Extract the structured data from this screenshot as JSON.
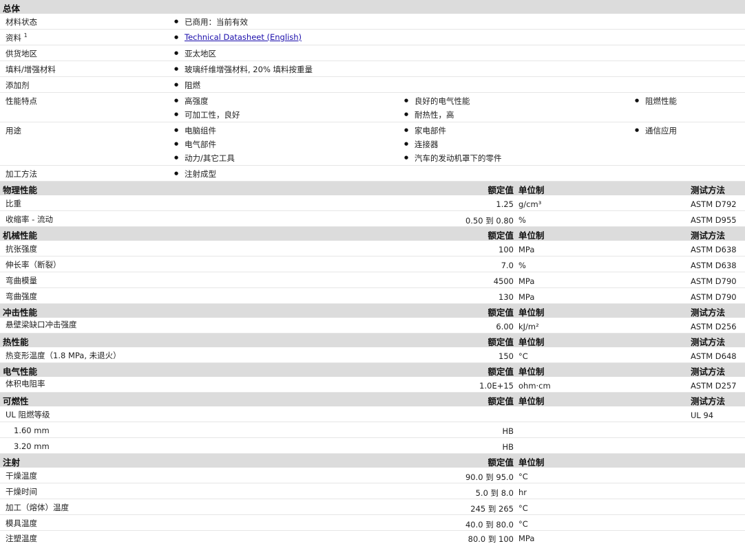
{
  "general": {
    "title": "总体",
    "rows": [
      {
        "label": "材料状态",
        "values": [
          "已商用：当前有效"
        ]
      },
      {
        "label": "资料",
        "sup": "1",
        "link": "Technical Datasheet (English)"
      },
      {
        "label": "供货地区",
        "values": [
          "亚太地区"
        ]
      },
      {
        "label": "填料/增强材料",
        "values": [
          "玻璃纤维增强材料, 20% 填料按重量"
        ]
      },
      {
        "label": "添加剂",
        "values": [
          "阻燃"
        ]
      },
      {
        "label": "性能特点",
        "cols": [
          [
            "高强度",
            "可加工性，良好"
          ],
          [
            "良好的电气性能",
            "耐热性，高"
          ],
          [
            "阻燃性能"
          ]
        ]
      },
      {
        "label": "用途",
        "cols": [
          [
            "电脑组件",
            "电气部件",
            "动力/其它工具"
          ],
          [
            "家电部件",
            "连接器",
            "汽车的发动机罩下的零件"
          ],
          [
            "通信应用"
          ]
        ]
      },
      {
        "label": "加工方法",
        "values": [
          "注射成型"
        ]
      }
    ]
  },
  "col_headers": {
    "nominal": "额定值",
    "unit": "单位制",
    "method": "测试方法"
  },
  "sections": [
    {
      "title": "物理性能",
      "method_header": true,
      "rows": [
        {
          "label": "比重",
          "value": "1.25",
          "unit": "g/cm³",
          "method": "ASTM D792"
        },
        {
          "label": "收缩率 - 流动",
          "value_from": "0.50",
          "to": "到",
          "value_to": "0.80",
          "unit": "%",
          "method": "ASTM D955"
        }
      ]
    },
    {
      "title": "机械性能",
      "method_header": true,
      "rows": [
        {
          "label": "抗张强度",
          "value": "100",
          "unit": "MPa",
          "method": "ASTM D638"
        },
        {
          "label": "伸长率（断裂）",
          "value": "7.0",
          "unit": "%",
          "method": "ASTM D638"
        },
        {
          "label": "弯曲模量",
          "value": "4500",
          "unit": "MPa",
          "method": "ASTM D790"
        },
        {
          "label": "弯曲强度",
          "value": "130",
          "unit": "MPa",
          "method": "ASTM D790"
        }
      ]
    },
    {
      "title": "冲击性能",
      "method_header": true,
      "rows": [
        {
          "label": "悬壁梁缺口冲击强度",
          "value": "6.00",
          "unit": "kJ/m²",
          "method": "ASTM D256"
        }
      ]
    },
    {
      "title": "热性能",
      "method_header": true,
      "rows": [
        {
          "label": "热变形温度（1.8 MPa, 未退火）",
          "value": "150",
          "unit": "°C",
          "method": "ASTM D648"
        }
      ]
    },
    {
      "title": "电气性能",
      "method_header": true,
      "rows": [
        {
          "label": "体积电阻率",
          "value": "1.0E+15",
          "unit": "ohm·cm",
          "method": "ASTM D257"
        }
      ]
    },
    {
      "title": "可燃性",
      "method_header": true,
      "rows": [
        {
          "label": "UL 阻燃等级",
          "value": "",
          "unit": "",
          "method": "UL 94"
        },
        {
          "label": "1.60 mm",
          "indent": true,
          "value": "HB",
          "unit": "",
          "method": ""
        },
        {
          "label": "3.20 mm",
          "indent": true,
          "value": "HB",
          "unit": "",
          "method": ""
        }
      ]
    },
    {
      "title": "注射",
      "method_header": false,
      "rows": [
        {
          "label": "干燥温度",
          "value_from": "90.0",
          "to": "到",
          "value_to": "95.0",
          "unit": "°C",
          "method": ""
        },
        {
          "label": "干燥时间",
          "value_from": "5.0",
          "to": "到",
          "value_to": "8.0",
          "unit": "hr",
          "method": ""
        },
        {
          "label": "加工（熔体）温度",
          "value_from": "245",
          "to": "到",
          "value_to": "265",
          "unit": "°C",
          "method": ""
        },
        {
          "label": "模具温度",
          "value_from": "40.0",
          "to": "到",
          "value_to": "80.0",
          "unit": "°C",
          "method": ""
        },
        {
          "label": "注塑温度",
          "value_from": "80.0",
          "to": "到",
          "value_to": "100",
          "unit": "MPa",
          "method": ""
        }
      ]
    }
  ]
}
